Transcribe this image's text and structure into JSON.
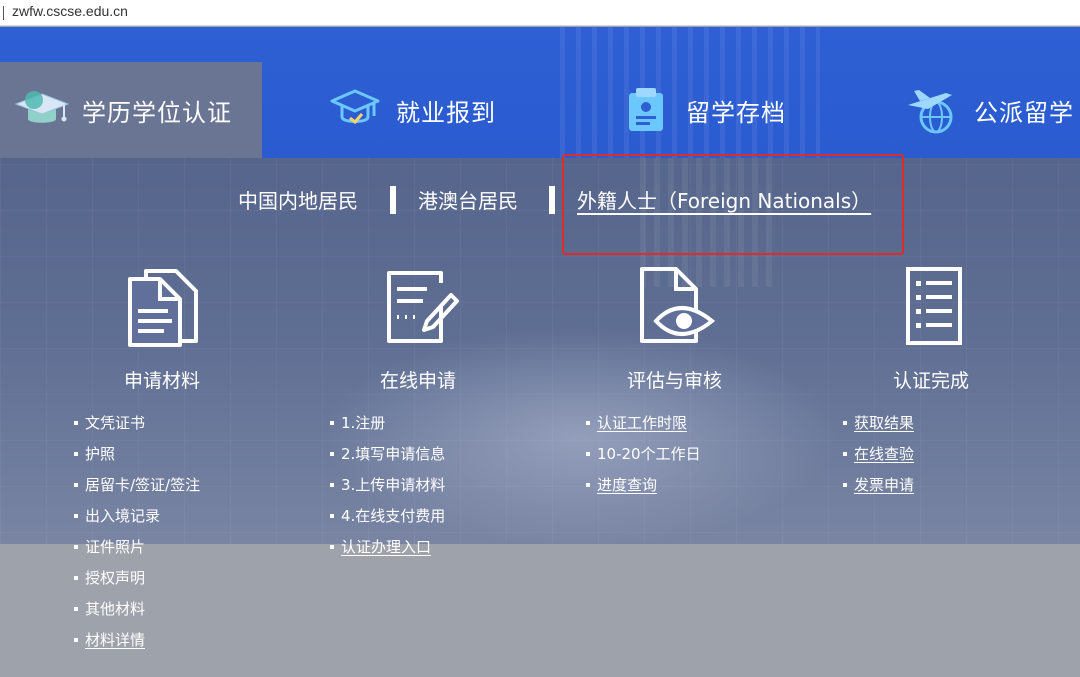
{
  "browser": {
    "url": "zwfw.cscse.edu.cn"
  },
  "nav": {
    "tabs": [
      {
        "label": "学历学位认证",
        "icon": "graduation-cap-icon"
      },
      {
        "label": "就业报到",
        "icon": "mortarboard-icon"
      },
      {
        "label": "留学存档",
        "icon": "archive-file-icon"
      },
      {
        "label": "公派留学",
        "icon": "airplane-globe-icon"
      }
    ]
  },
  "subnav": {
    "items": [
      "中国内地居民",
      "港澳台居民",
      "外籍人士（Foreign Nationals）"
    ]
  },
  "steps": [
    {
      "title": "申请材料",
      "icon": "documents-icon",
      "items": [
        "文凭证书",
        "护照",
        "居留卡/签证/签注",
        "出入境记录",
        "证件照片",
        "授权声明",
        "其他材料",
        "材料详情"
      ]
    },
    {
      "title": "在线申请",
      "icon": "edit-form-icon",
      "items": [
        "1.注册",
        "2.填写申请信息",
        "3.上传申请材料",
        "4.在线支付费用",
        "认证办理入口"
      ]
    },
    {
      "title": "评估与审核",
      "icon": "document-eye-icon",
      "items": [
        "认证工作时限",
        "10-20个工作日",
        "进度查询"
      ]
    },
    {
      "title": "认证完成",
      "icon": "checklist-icon",
      "items": [
        "获取结果",
        "在线查验",
        "发票申请"
      ]
    }
  ],
  "colors": {
    "nav_blue": "#2e5fd3",
    "active_tab": "#6a7594",
    "highlight_red": "#e02b2b"
  }
}
